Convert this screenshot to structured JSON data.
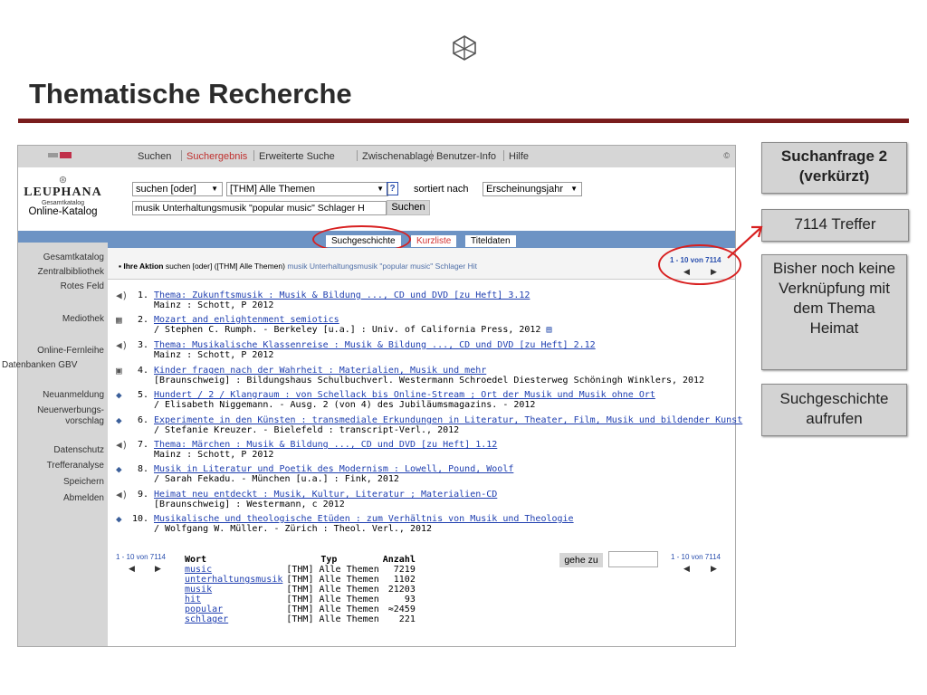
{
  "slide": {
    "title": "Thematische Recherche",
    "accent_color": "#7a1d1d"
  },
  "app": {
    "library_name": "LEUPHANA",
    "library_sub": "Gesamtkatalog",
    "catalog_name": "Online-Katalog",
    "copyright": "©"
  },
  "menu": [
    "Suchen",
    "Suchergebnis",
    "Erweiterte Suche",
    "Zwischenablage",
    "Benutzer-Info",
    "Hilfe"
  ],
  "form": {
    "search_mode": "suchen [oder]",
    "field": "[THM] Alle Themen",
    "help_icon": "?",
    "sort_label": "sortiert nach",
    "sort_value": "Erscheinungsjahr",
    "query": "musik Unterhaltungsmusik \"popular music\" Schlager H",
    "search_button": "Suchen"
  },
  "tabs": [
    "Suchgeschichte",
    "Kurzliste",
    "Titeldaten"
  ],
  "sidebar": {
    "items": [
      "Gesamtkatalog",
      "Zentralbibliothek",
      "Rotes Feld",
      "Mediothek",
      "Online-Fernleihe",
      "Datenbanken GBV",
      "Neuanmeldung",
      "Neuerwerbungs-",
      "vorschlag",
      "Datenschutz",
      "Trefferanalyse",
      "Speichern",
      "Abmelden"
    ]
  },
  "action": {
    "label": "Ihre Aktion",
    "text": "suchen [oder] ([THM] Alle Themen)",
    "query": "musik Unterhaltungsmusik \"popular music\" Schlager Hit",
    "pagination": "1 - 10 von 7114"
  },
  "results": [
    {
      "num": "1.",
      "icon": "speaker-icon",
      "title": "Thema: Zukunftsmusik : Musik & Bildung ..., CD und DVD [zu Heft] 3.12",
      "meta": "Mainz : Schott, P 2012"
    },
    {
      "num": "2.",
      "icon": "microfiche-icon",
      "title": "Mozart and enlightenment semiotics",
      "meta": "/ Stephen C. Rumph. - Berkeley [u.a.] : Univ. of California Press, 2012"
    },
    {
      "num": "3.",
      "icon": "speaker-icon",
      "title": "Thema: Musikalische Klassenreise : Musik & Bildung ..., CD und DVD [zu Heft] 2.12",
      "meta": "Mainz : Schott, P 2012"
    },
    {
      "num": "4.",
      "icon": "disk-icon",
      "title": "Kinder fragen nach der Wahrheit : Materialien, Musik und mehr",
      "meta": "[Braunschweig] : Bildungshaus Schulbuchverl. Westermann Schroedel Diesterweg Schöningh Winklers, 2012"
    },
    {
      "num": "5.",
      "icon": "book-icon",
      "title": "Hundert / 2 / Klangraum : von Schellack bis Online-Stream ; Ort der Musik und Musik ohne Ort",
      "meta": "/ Elisabeth Niggemann. - Ausg. 2 (von 4) des Jubiläumsmagazins. - 2012"
    },
    {
      "num": "6.",
      "icon": "book-icon",
      "title": "Experimente in den Künsten : transmediale Erkundungen in Literatur, Theater, Film, Musik und bildender Kunst",
      "meta": "/ Stefanie Kreuzer. - Bielefeld : transcript-Verl., 2012"
    },
    {
      "num": "7.",
      "icon": "speaker-icon",
      "title": "Thema: Märchen : Musik & Bildung ..., CD und DVD [zu Heft] 1.12",
      "meta": "Mainz : Schott, P 2012"
    },
    {
      "num": "8.",
      "icon": "book-icon",
      "title": "Musik in Literatur und Poetik des Modernism : Lowell, Pound, Woolf",
      "meta": "/ Sarah Fekadu. - München [u.a.] : Fink, 2012"
    },
    {
      "num": "9.",
      "icon": "speaker-icon",
      "title": "Heimat neu entdeckt : Musik, Kultur, Literatur ; Materialien-CD",
      "meta": "[Braunschweig] : Westermann, c 2012"
    },
    {
      "num": "10.",
      "icon": "book-icon",
      "title": "Musikalische und theologische Etüden : zum Verhältnis von Musik und Theologie",
      "meta": "/ Wolfgang W. Müller. - Zürich : Theol. Verl., 2012"
    }
  ],
  "words": {
    "headers": [
      "Wort",
      "Typ",
      "Anzahl"
    ],
    "rows": [
      {
        "word": "music",
        "type": "[THM] Alle Themen",
        "count": "7219"
      },
      {
        "word": "unterhaltungsmusik",
        "type": "[THM] Alle Themen",
        "count": "1102"
      },
      {
        "word": "musik",
        "type": "[THM] Alle Themen",
        "count": "21203"
      },
      {
        "word": "hit",
        "type": "[THM] Alle Themen",
        "count": "93"
      },
      {
        "word": "popular",
        "type": "[THM] Alle Themen",
        "count": "≈2459"
      },
      {
        "word": "schlager",
        "type": "[THM] Alle Themen",
        "count": "221"
      }
    ]
  },
  "bottom": {
    "pagination": "1 - 10 von 7114",
    "goto_label": "gehe zu"
  },
  "callouts": {
    "query_title": "Suchanfrage 2 (verkürzt)",
    "hits": "7114 Treffer",
    "note": "Bisher noch keine Verknüpfung mit dem Thema Heimat",
    "history": "Suchgeschichte aufrufen"
  },
  "colors": {
    "highlight": "#d82020",
    "blue_bar": "#6d93c4",
    "link": "#1f3fb0"
  }
}
